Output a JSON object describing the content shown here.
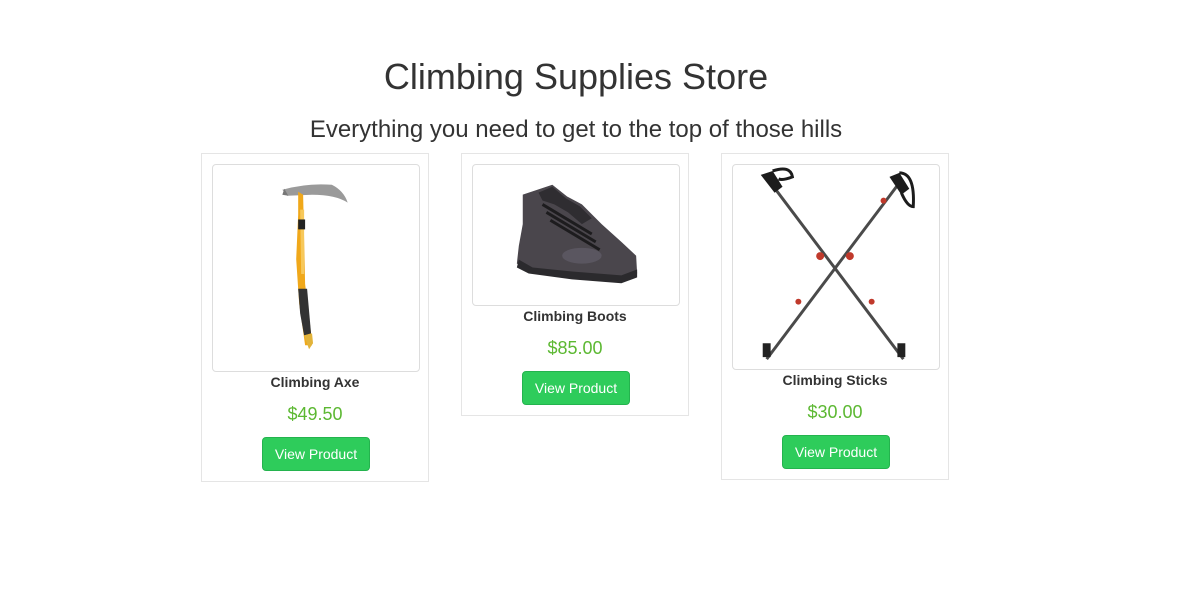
{
  "header": {
    "title": "Climbing Supplies Store",
    "subtitle": "Everything you need to get to the top of those hills"
  },
  "products": [
    {
      "name": "Climbing Axe",
      "price": "$49.50",
      "button_label": "View Product",
      "image_icon": "ice-axe-image"
    },
    {
      "name": "Climbing Boots",
      "price": "$85.00",
      "button_label": "View Product",
      "image_icon": "hiking-boot-image"
    },
    {
      "name": "Climbing Sticks",
      "price": "$30.00",
      "button_label": "View Product",
      "image_icon": "trekking-poles-image"
    }
  ],
  "colors": {
    "price": "#5cb832",
    "button": "#2ecc5b",
    "text": "#333333"
  }
}
